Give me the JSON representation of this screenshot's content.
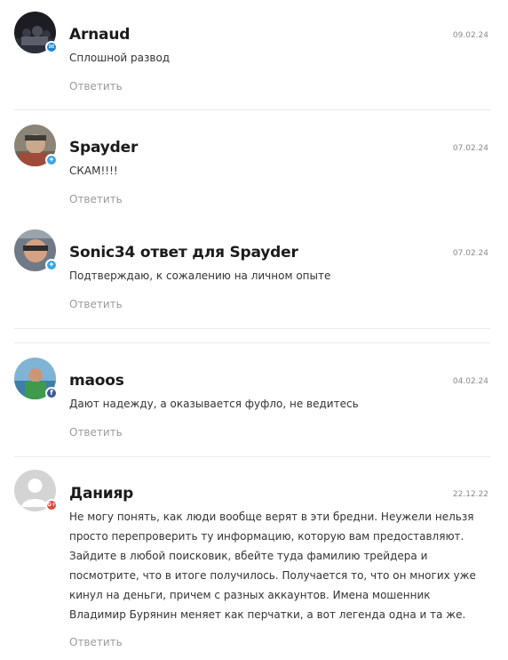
{
  "comments": [
    {
      "name": "Arnaud",
      "date": "09.02.24",
      "text": "Сплошной развод",
      "reply": "Ответить",
      "badge": "email-icon",
      "badge_color": "#1e88d3"
    },
    {
      "name": "Spayder",
      "date": "07.02.24",
      "text": "СКАМ!!!!",
      "reply": "Ответить",
      "badge": "twitter-icon",
      "badge_color": "#3aa8e6"
    },
    {
      "name": "Sonic34 ответ для Spayder",
      "date": "07.02.24",
      "text": "Подтверждаю, к сожалению на личном опыте",
      "reply": "Ответить",
      "badge": "twitter-icon",
      "badge_color": "#3aa8e6"
    },
    {
      "name": "maoos",
      "date": "04.02.24",
      "text": "Дают надежду, а оказывается фуфло, не ведитесь",
      "reply": "Ответить",
      "badge": "facebook-icon",
      "badge_color": "#3b5998"
    },
    {
      "name": "Данияр",
      "date": "22.12.22",
      "text": "Не могу понять, как люди вообще верят в эти бредни. Неужели нельзя просто перепроверить ту информацию, которую вам предоставляют. Зайдите в любой поисковик, вбейте туда фамилию трейдера и посмотрите, что в итоге получилось. Получается то, что он многих уже кинул на деньги, причем с разных аккаунтов. Имена мошенник Владимир Бурянин меняет как перчатки, а вот легенда одна и та же.",
      "reply": "Ответить",
      "badge": "google-plus-icon",
      "badge_color": "#dd4b39",
      "badge_text": "G+"
    }
  ]
}
